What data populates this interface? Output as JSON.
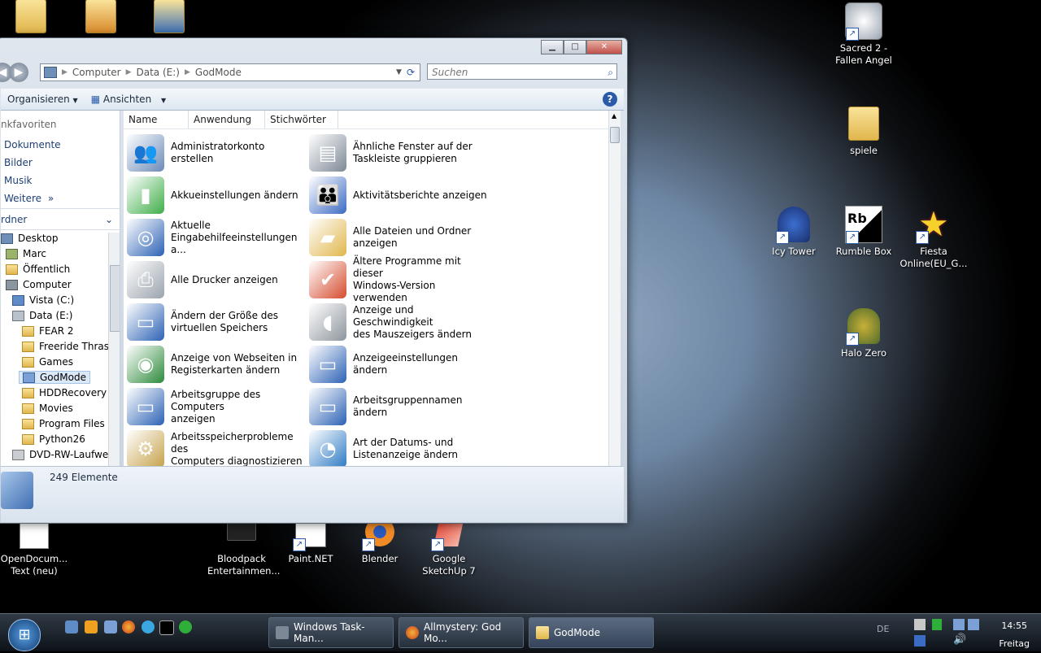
{
  "desktop": {
    "icons": [
      {
        "label": "Sacred 2 -\nFallen Angel",
        "line1": "Sacred 2 -",
        "line2": "Fallen Angel"
      },
      {
        "label": "spiele"
      },
      {
        "label": "Icy Tower"
      },
      {
        "label": "Rumble Box"
      },
      {
        "label": "Fiesta Online(EU_G...",
        "line1": "Fiesta",
        "line2": "Online(EU_G..."
      },
      {
        "label": "Halo Zero"
      },
      {
        "label": "OpenDocum... Text (neu)",
        "line1": "OpenDocum...",
        "line2": "Text (neu)"
      },
      {
        "label": "Bloodpack Entertainmen...",
        "line1": "Bloodpack",
        "line2": "Entertainmen..."
      },
      {
        "label": "Paint.NET"
      },
      {
        "label": "Blender"
      },
      {
        "label": "Google SketchUp 7",
        "line1": "Google",
        "line2": "SketchUp 7"
      }
    ]
  },
  "window": {
    "breadcrumb": [
      "Computer",
      "Data (E:)",
      "GodMode"
    ],
    "search_placeholder": "Suchen",
    "toolbar": {
      "organize": "Organisieren",
      "views": "Ansichten"
    },
    "nav": {
      "favorites_header": "nkfavoriten",
      "favorites": [
        "Dokumente",
        "Bilder",
        "Musik",
        "Weitere"
      ],
      "more_chevron": "»",
      "folders_header": "rdner",
      "tree": [
        {
          "label": "Desktop"
        },
        {
          "label": "Marc"
        },
        {
          "label": "Öffentlich"
        },
        {
          "label": "Computer"
        },
        {
          "label": "Vista (C:)"
        },
        {
          "label": "Data (E:)"
        },
        {
          "label": "FEAR 2"
        },
        {
          "label": "Freeride Thrash"
        },
        {
          "label": "Games"
        },
        {
          "label": "GodMode",
          "selected": true
        },
        {
          "label": "HDDRecovery"
        },
        {
          "label": "Movies"
        },
        {
          "label": "Program Files"
        },
        {
          "label": "Python26"
        },
        {
          "label": "DVD-RW-Laufwer"
        }
      ]
    },
    "columns": [
      "Name",
      "Anwendung",
      "Stichwörter"
    ],
    "items": [
      {
        "l1": "Administratorkonto erstellen",
        "l2": "",
        "icon": "users-icon",
        "color": "#6b8ab8"
      },
      {
        "l1": "Ähnliche Fenster auf der",
        "l2": "Taskleiste gruppieren",
        "icon": "taskbar-icon",
        "color": "#7d8896"
      },
      {
        "l1": "Akkueinstellungen ändern",
        "l2": "",
        "icon": "battery-icon",
        "color": "#3fae49"
      },
      {
        "l1": "Aktivitätsberichte anzeigen",
        "l2": "",
        "icon": "parental-icon",
        "color": "#3c6bc4"
      },
      {
        "l1": "Aktuelle",
        "l2": "Eingabehilfeeinstellungen a...",
        "icon": "accessibility-icon",
        "color": "#2d62b5"
      },
      {
        "l1": "Alle Dateien und Ordner",
        "l2": "anzeigen",
        "icon": "folder-icon",
        "color": "#e1b64c"
      },
      {
        "l1": "Alle Drucker anzeigen",
        "l2": "",
        "icon": "printer-icon",
        "color": "#9aa3ad"
      },
      {
        "l1": "Ältere Programme mit dieser",
        "l2": "Windows-Version verwenden",
        "icon": "windows-check-icon",
        "color": "#d54b2e"
      },
      {
        "l1": "Ändern der Größe des",
        "l2": "virtuellen Speichers",
        "icon": "monitor-icon",
        "color": "#2d62b5"
      },
      {
        "l1": "Anzeige und Geschwindigkeit",
        "l2": "des Mauszeigers ändern",
        "icon": "mouse-icon",
        "color": "#8e959d"
      },
      {
        "l1": "Anzeige von Webseiten in",
        "l2": "Registerkarten ändern",
        "icon": "globe-list-icon",
        "color": "#2e8a3c"
      },
      {
        "l1": "Anzeigeeinstellungen ändern",
        "l2": "",
        "icon": "display-icon",
        "color": "#2d62b5"
      },
      {
        "l1": "Arbeitsgruppe des Computers",
        "l2": "anzeigen",
        "icon": "monitor-icon",
        "color": "#2d62b5"
      },
      {
        "l1": "Arbeitsgruppennamen",
        "l2": "ändern",
        "icon": "monitor-icon",
        "color": "#2d62b5"
      },
      {
        "l1": "Arbeitsspeicherprobleme des",
        "l2": "Computers diagnostizieren",
        "icon": "tools-icon",
        "color": "#c6a14a"
      },
      {
        "l1": "Art der Datums- und",
        "l2": "Listenanzeige ändern",
        "icon": "globe-clock-icon",
        "color": "#2e7ac4"
      }
    ],
    "status": "249 Elemente"
  },
  "taskbar": {
    "tasks": [
      {
        "label": "Windows Task-Man..."
      },
      {
        "label": "Allmystery: God Mo..."
      },
      {
        "label": "GodMode"
      }
    ],
    "clock": {
      "time": "14:55",
      "day": "Freitag"
    },
    "tray_lang": "DE"
  }
}
